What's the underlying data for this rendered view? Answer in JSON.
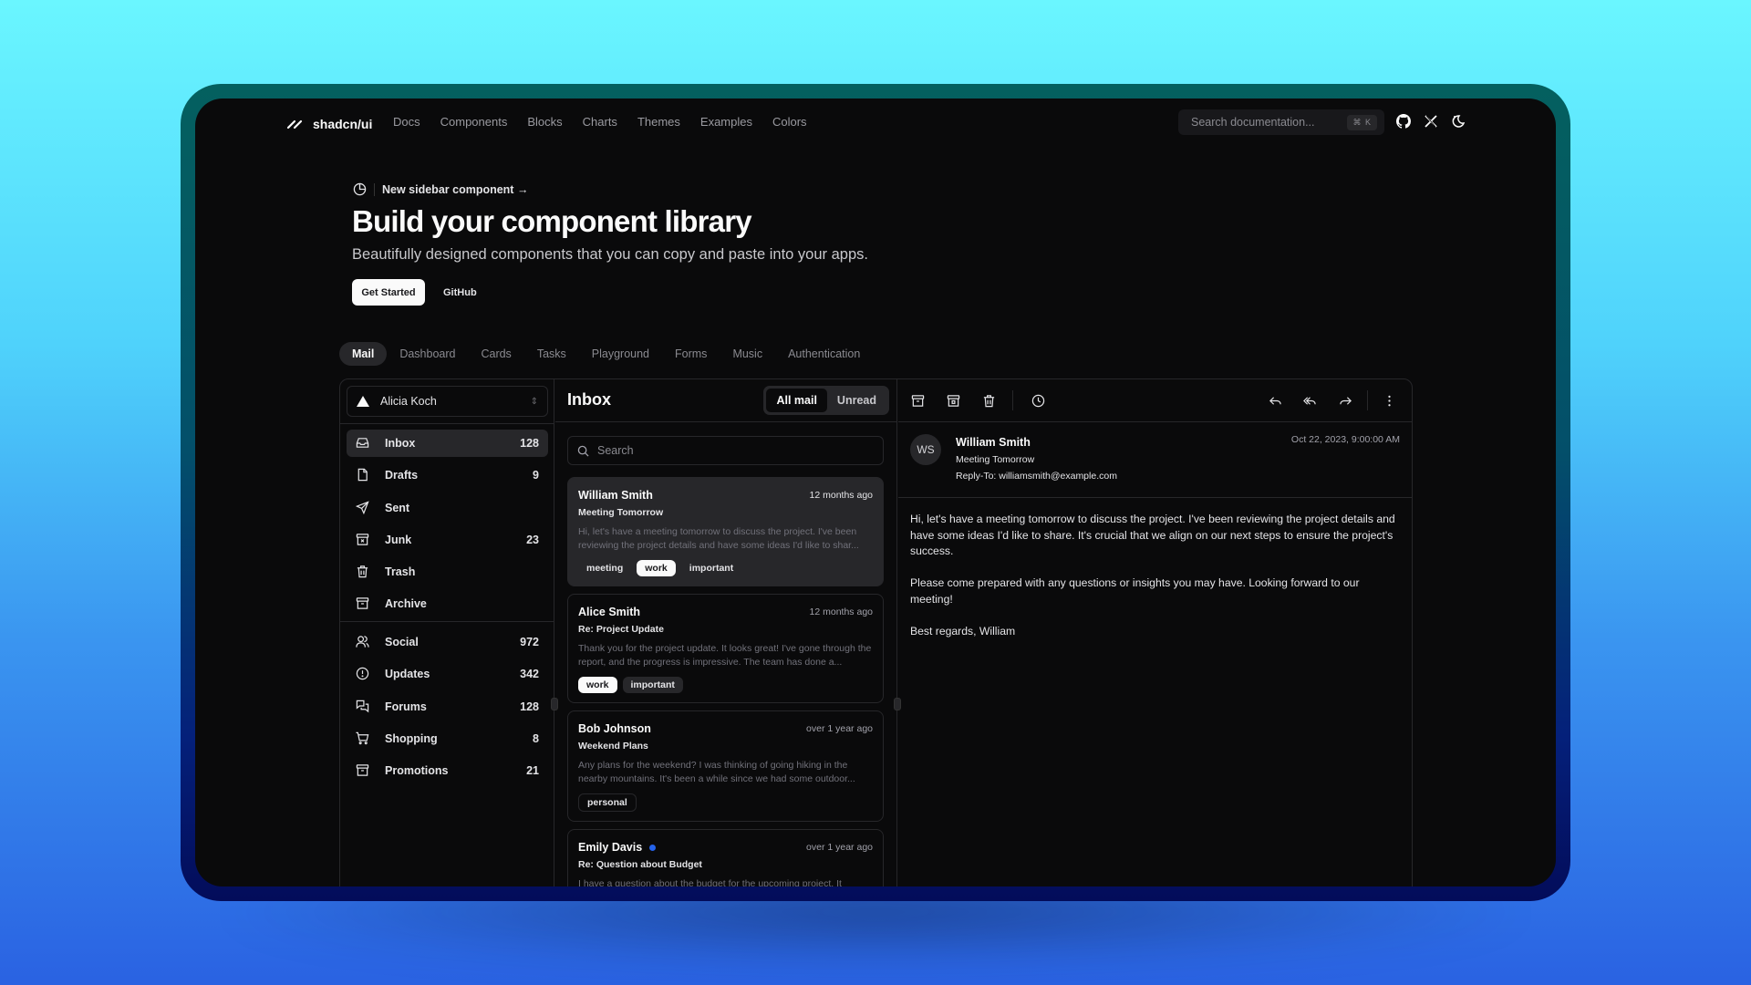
{
  "site": {
    "logo_text": "shadcn/ui",
    "nav_links": [
      "Docs",
      "Components",
      "Blocks",
      "Charts",
      "Themes",
      "Examples",
      "Colors"
    ],
    "search": {
      "placeholder": "Search documentation...",
      "shortcut": "⌘ K"
    },
    "icons": [
      "github-icon",
      "x-twitter-icon",
      "theme-toggle-icon"
    ]
  },
  "hero": {
    "announcement": "New sidebar component →",
    "title": "Build your component library",
    "subtitle": "Beautifully designed components that you can copy and paste into your apps.",
    "primary_button": "Get Started",
    "secondary_button": "GitHub"
  },
  "tabs": [
    {
      "label": "Mail",
      "active": true
    },
    {
      "label": "Dashboard"
    },
    {
      "label": "Cards"
    },
    {
      "label": "Tasks"
    },
    {
      "label": "Playground"
    },
    {
      "label": "Forms"
    },
    {
      "label": "Music"
    },
    {
      "label": "Authentication"
    }
  ],
  "mail": {
    "account": "Alicia Koch",
    "primary_nav": [
      {
        "label": "Inbox",
        "count": "128",
        "icon": "inbox-icon",
        "active": true
      },
      {
        "label": "Drafts",
        "count": "9",
        "icon": "file-icon"
      },
      {
        "label": "Sent",
        "count": "",
        "icon": "send-icon"
      },
      {
        "label": "Junk",
        "count": "23",
        "icon": "archive-x-icon"
      },
      {
        "label": "Trash",
        "count": "",
        "icon": "trash-icon"
      },
      {
        "label": "Archive",
        "count": "",
        "icon": "archive-icon"
      }
    ],
    "secondary_nav": [
      {
        "label": "Social",
        "count": "972",
        "icon": "users-icon"
      },
      {
        "label": "Updates",
        "count": "342",
        "icon": "alert-circle-icon"
      },
      {
        "label": "Forums",
        "count": "128",
        "icon": "messages-icon"
      },
      {
        "label": "Shopping",
        "count": "8",
        "icon": "cart-icon"
      },
      {
        "label": "Promotions",
        "count": "21",
        "icon": "archive-icon"
      }
    ],
    "list": {
      "title": "Inbox",
      "filters": [
        "All mail",
        "Unread"
      ],
      "active_filter": "All mail",
      "search_placeholder": "Search",
      "emails": [
        {
          "from": "William Smith",
          "time": "12 months ago",
          "subject": "Meeting Tomorrow",
          "preview": "Hi, let's have a meeting tomorrow to discuss the project. I've been reviewing the project details and have some ideas I'd like to shar...",
          "tags": [
            {
              "label": "meeting",
              "variant": "secondary"
            },
            {
              "label": "work",
              "variant": "default"
            },
            {
              "label": "important",
              "variant": "secondary"
            }
          ],
          "selected": true,
          "unread": false
        },
        {
          "from": "Alice Smith",
          "time": "12 months ago",
          "subject": "Re: Project Update",
          "preview": "Thank you for the project update. It looks great! I've gone through the report, and the progress is impressive. The team has done a...",
          "tags": [
            {
              "label": "work",
              "variant": "default"
            },
            {
              "label": "important",
              "variant": "secondary"
            }
          ],
          "selected": false,
          "unread": false
        },
        {
          "from": "Bob Johnson",
          "time": "over 1 year ago",
          "subject": "Weekend Plans",
          "preview": "Any plans for the weekend? I was thinking of going hiking in the nearby mountains. It's been a while since we had some outdoor...",
          "tags": [
            {
              "label": "personal",
              "variant": "outline"
            }
          ],
          "selected": false,
          "unread": false
        },
        {
          "from": "Emily Davis",
          "time": "over 1 year ago",
          "subject": "Re: Question about Budget",
          "preview": "I have a question about the budget for the upcoming project. It",
          "tags": [],
          "selected": false,
          "unread": true
        }
      ]
    },
    "view": {
      "toolbar_left": [
        "archive-icon",
        "archive-x-icon",
        "trash-icon",
        "clock-icon"
      ],
      "toolbar_right": [
        "reply-icon",
        "reply-all-icon",
        "forward-icon",
        "more-vertical-icon"
      ],
      "avatar_initials": "WS",
      "from": "William Smith",
      "subject": "Meeting Tomorrow",
      "reply_to": "Reply-To: williamsmith@example.com",
      "date": "Oct 22, 2023, 9:00:00 AM",
      "body": [
        "Hi, let's have a meeting tomorrow to discuss the project. I've been reviewing the project details and have some ideas I'd like to share. It's crucial that we align on our next steps to ensure the project's success.",
        "Please come prepared with any questions or insights you may have. Looking forward to our meeting!",
        "Best regards, William"
      ]
    }
  },
  "colors": {
    "unread_dot": "#2563eb",
    "background_top": "#6af6ff",
    "background_bottom": "#2a62e2"
  }
}
